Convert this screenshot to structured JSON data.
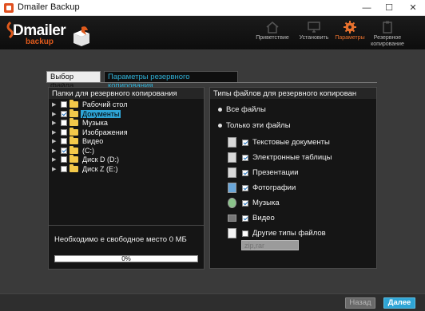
{
  "window": {
    "title": "Dmailer Backup",
    "min_glyph": "—",
    "max_glyph": "☐",
    "close_glyph": "✕"
  },
  "logo": {
    "word": "Dmailer",
    "sub": "backup"
  },
  "nav": [
    {
      "label": "Приветствие",
      "icon": "home-icon"
    },
    {
      "label": "Установить",
      "icon": "monitor-icon"
    },
    {
      "label": "Параметры",
      "icon": "gear-icon",
      "active": true
    },
    {
      "label_line1": "Резервное",
      "label_line2": "копирование",
      "icon": "clipboard-icon"
    }
  ],
  "tabs": {
    "file_select": "Выбор файла",
    "backup_params": "Параметры резервного копирования"
  },
  "folders_panel": {
    "title": "Папки для резервного копирования",
    "items": [
      {
        "name": "Рабочий стол",
        "checked": false,
        "selected": false
      },
      {
        "name": "Документы",
        "checked": true,
        "selected": true
      },
      {
        "name": "Музыка",
        "checked": false,
        "selected": false
      },
      {
        "name": "Изображения",
        "checked": false,
        "selected": false
      },
      {
        "name": "Видео",
        "checked": false,
        "selected": false
      },
      {
        "name": "(C:)",
        "checked": true,
        "selected": false
      },
      {
        "name": "Диск D (D:)",
        "checked": false,
        "selected": false
      },
      {
        "name": "Диск Z (E:)",
        "checked": false,
        "selected": false
      }
    ]
  },
  "space": {
    "label": "Необходимо е свободное место 0 МБ",
    "progress_percent": 0,
    "progress_text": "0%"
  },
  "types_panel": {
    "title": "Типы файлов для резервного копирован",
    "all_files": "Все файлы",
    "only_files": "Только эти файлы",
    "types": [
      {
        "label": "Текстовые документы",
        "checked": true,
        "icon": "text-doc-icon"
      },
      {
        "label": "Электронные таблицы",
        "checked": true,
        "icon": "spreadsheet-icon"
      },
      {
        "label": "Презентации",
        "checked": true,
        "icon": "presentation-icon"
      },
      {
        "label": "Фотографии",
        "checked": true,
        "icon": "photo-icon"
      },
      {
        "label": "Музыка",
        "checked": true,
        "icon": "music-icon"
      },
      {
        "label": "Видео",
        "checked": true,
        "icon": "video-icon"
      },
      {
        "label": "Другие типы файлов",
        "checked": false,
        "icon": "blank-file-icon"
      }
    ],
    "ext_placeholder": "zip,rar"
  },
  "footer": {
    "back": "Назад",
    "next": "Далее"
  },
  "colors": {
    "accent": "#2fa5d6",
    "brand": "#e05a1c"
  }
}
